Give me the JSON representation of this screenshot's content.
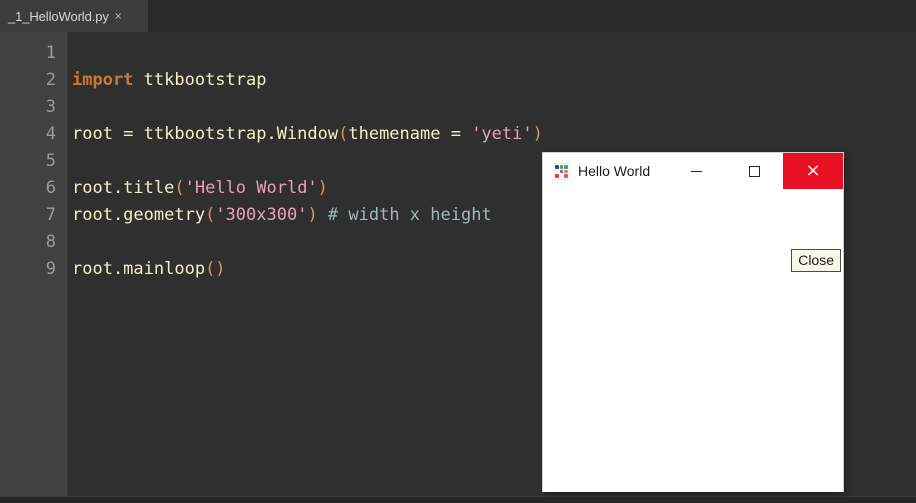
{
  "editor": {
    "tab": {
      "label": "_1_HelloWorld.py",
      "close_glyph": "×"
    },
    "line_numbers": [
      "1",
      "2",
      "3",
      "4",
      "5",
      "6",
      "7",
      "8",
      "9"
    ],
    "lines": [
      {
        "n": "1",
        "tokens": []
      },
      {
        "n": "2",
        "tokens": [
          {
            "t": "import",
            "c": "tok-kw"
          },
          {
            "t": " ttkbootstrap",
            "c": "tok-plain"
          }
        ]
      },
      {
        "n": "3",
        "tokens": []
      },
      {
        "n": "4",
        "tokens": [
          {
            "t": "root = ttkbootstrap.Window",
            "c": "tok-plain"
          },
          {
            "t": "(",
            "c": "tok-paren"
          },
          {
            "t": "themename = ",
            "c": "tok-plain"
          },
          {
            "t": "'yeti'",
            "c": "tok-str"
          },
          {
            "t": ")",
            "c": "tok-paren"
          }
        ]
      },
      {
        "n": "5",
        "tokens": []
      },
      {
        "n": "6",
        "tokens": [
          {
            "t": "root.title",
            "c": "tok-plain"
          },
          {
            "t": "(",
            "c": "tok-paren"
          },
          {
            "t": "'Hello World'",
            "c": "tok-str"
          },
          {
            "t": ")",
            "c": "tok-paren"
          }
        ]
      },
      {
        "n": "7",
        "tokens": [
          {
            "t": "root.geometry",
            "c": "tok-plain"
          },
          {
            "t": "(",
            "c": "tok-paren"
          },
          {
            "t": "'300x300'",
            "c": "tok-str"
          },
          {
            "t": ")",
            "c": "tok-paren"
          },
          {
            "t": " # width x height",
            "c": "tok-comment"
          }
        ]
      },
      {
        "n": "8",
        "tokens": []
      },
      {
        "n": "9",
        "tokens": [
          {
            "t": "root.mainloop",
            "c": "tok-plain"
          },
          {
            "t": "()",
            "c": "tok-paren"
          }
        ]
      }
    ],
    "colors": {
      "background": "#2f2f2f",
      "gutter": "#414141",
      "tab_bar": "#2b2b2b",
      "active_tab": "#3c3c3c",
      "keyword": "#cc7832",
      "string": "#e8a0b4",
      "comment": "#9fb8bd",
      "plain": "#f3f0c8",
      "paren": "#d9955f",
      "line_number": "#9c9c9c"
    }
  },
  "tk_window": {
    "title": "Hello World",
    "app_icon": "ttkbootstrap-icon",
    "icon_dot_colors": [
      "#3b3f7a",
      "#4f9f4a",
      "#2f9fa8",
      "#f2f2f2",
      "#8a4fd0",
      "#e98a26",
      "#d8433a",
      "#f2f2f2",
      "#d94f8f"
    ],
    "controls": {
      "minimize": "minimize-glyph",
      "maximize": "maximize-glyph",
      "close": "×"
    },
    "close_button_label": "Close",
    "colors": {
      "client_background": "#ffffff",
      "titlebar": "#ffffff",
      "close_highlight": "#e81123",
      "button_face": "#f7f7e8",
      "button_border": "#4b4b3f"
    }
  }
}
